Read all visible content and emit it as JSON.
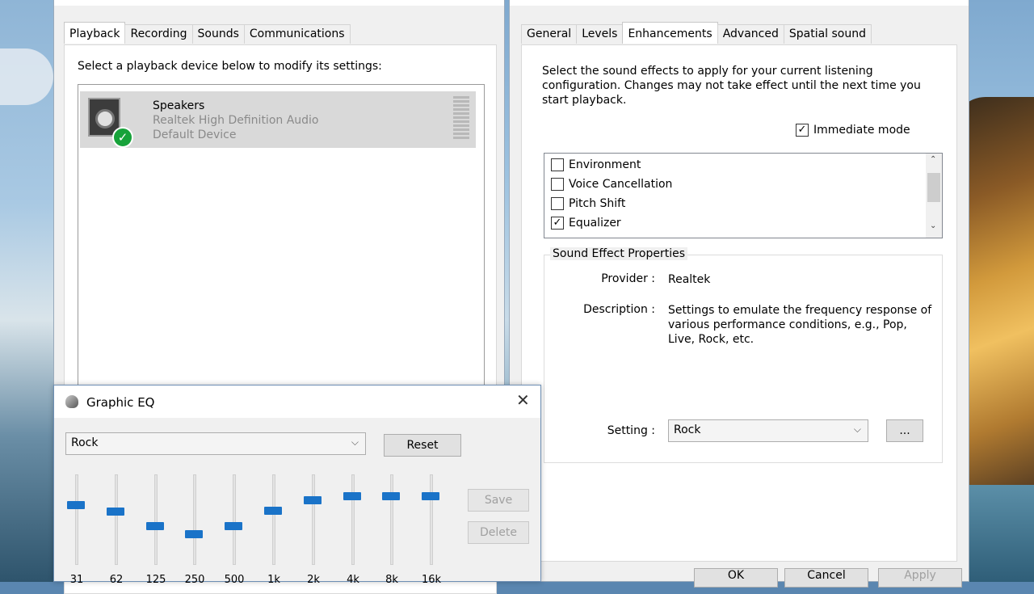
{
  "playback_window": {
    "tabs": [
      "Playback",
      "Recording",
      "Sounds",
      "Communications"
    ],
    "instruction": "Select a playback device below to modify its settings:",
    "device": {
      "name": "Speakers",
      "driver": "Realtek High Definition Audio",
      "status": "Default Device"
    }
  },
  "properties_window": {
    "tabs": [
      "General",
      "Levels",
      "Enhancements",
      "Advanced",
      "Spatial sound"
    ],
    "description": "Select the sound effects to apply for your current listening configuration. Changes may not take effect until the next time you start playback.",
    "immediate_mode_label": "Immediate mode",
    "immediate_mode_checked": true,
    "effects": [
      {
        "label": "Environment",
        "checked": false
      },
      {
        "label": "Voice Cancellation",
        "checked": false
      },
      {
        "label": "Pitch Shift",
        "checked": false
      },
      {
        "label": "Equalizer",
        "checked": true
      }
    ],
    "group_title": "Sound Effect Properties",
    "provider_key": "Provider :",
    "provider_value": "Realtek",
    "description_key": "Description :",
    "description_value": "Settings to emulate the frequency response of various performance conditions,  e.g., Pop, Live, Rock, etc.",
    "setting_key": "Setting :",
    "setting_value": "Rock",
    "more_button": "...",
    "buttons": [
      "OK",
      "Cancel",
      "Apply"
    ]
  },
  "graphic_eq": {
    "title": "Graphic EQ",
    "preset": "Rock",
    "reset": "Reset",
    "save": "Save",
    "delete": "Delete",
    "bands": [
      {
        "label": "31",
        "level": 0.68
      },
      {
        "label": "62",
        "level": 0.6
      },
      {
        "label": "125",
        "level": 0.42
      },
      {
        "label": "250",
        "level": 0.32
      },
      {
        "label": "500",
        "level": 0.42
      },
      {
        "label": "1k",
        "level": 0.61
      },
      {
        "label": "2k",
        "level": 0.74
      },
      {
        "label": "4k",
        "level": 0.78
      },
      {
        "label": "8k",
        "level": 0.78
      },
      {
        "label": "16k",
        "level": 0.78
      }
    ]
  }
}
